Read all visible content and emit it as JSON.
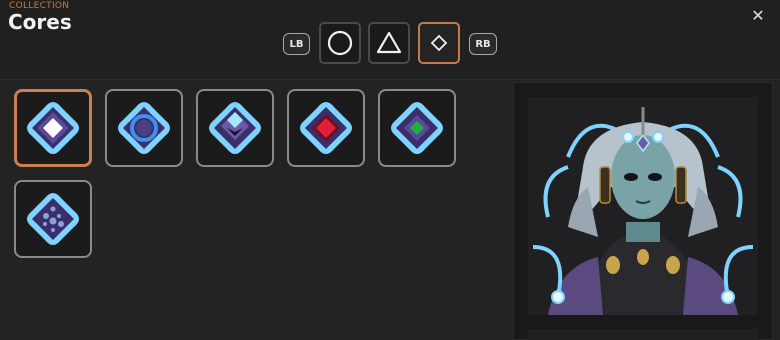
{
  "header": {
    "eyebrow": "COLLECTION",
    "title": "Cores",
    "close_icon": "close-icon"
  },
  "tabs": {
    "left_bumper": "LB",
    "right_bumper": "RB",
    "items": [
      {
        "icon": "circle-icon",
        "active": false
      },
      {
        "icon": "triangle-icon",
        "active": false
      },
      {
        "icon": "diamond-icon",
        "active": true
      }
    ]
  },
  "cores": [
    {
      "icon": "white-diamond-core-icon",
      "selected": true,
      "color": "#ffffff"
    },
    {
      "icon": "blue-ring-core-icon",
      "selected": false,
      "color": "#3d8ff0"
    },
    {
      "icon": "split-diamond-core-icon",
      "selected": false,
      "color": "#a8e8ff"
    },
    {
      "icon": "red-core-icon",
      "selected": false,
      "color": "#e0203a"
    },
    {
      "icon": "green-core-icon",
      "selected": false,
      "color": "#20b040"
    },
    {
      "icon": "dotted-core-icon",
      "selected": false,
      "color": "#6a7fc8"
    }
  ],
  "colors": {
    "accent": "#c8793d",
    "selected_border": "#c8814f",
    "glow": "#7fd4ff"
  }
}
